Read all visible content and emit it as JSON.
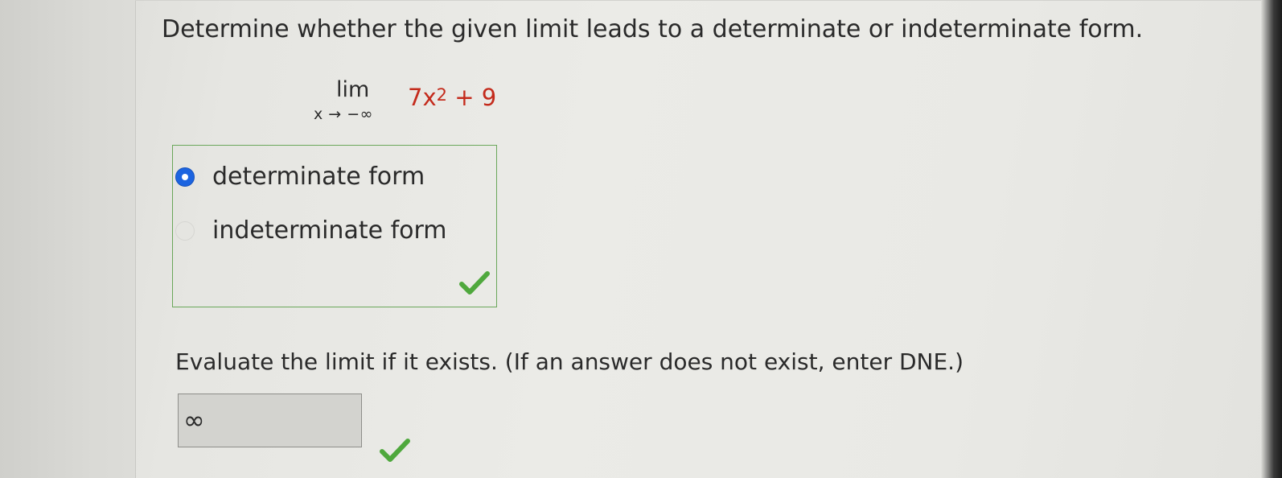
{
  "question": {
    "text": "Determine whether the given limit leads to a determinate or indeterminate form."
  },
  "limit": {
    "operator": "lim",
    "subscript": "x → −∞",
    "body_base": "7x",
    "body_exponent": "2",
    "body_rest": " + 9",
    "body_color": "#c42b1c"
  },
  "choices": {
    "items": [
      {
        "label": "determinate form",
        "selected": true
      },
      {
        "label": "indeterminate form",
        "selected": false
      }
    ],
    "status_icon": "check-icon",
    "box_border_color": "#6aa75a"
  },
  "evaluate": {
    "prompt": "Evaluate the limit if it exists. (If an answer does not exist, enter DNE.)",
    "answer_value": "∞",
    "status_icon": "check-icon"
  },
  "colors": {
    "radio_selected": "#1c64e0",
    "correct_check": "#4fa83d"
  }
}
